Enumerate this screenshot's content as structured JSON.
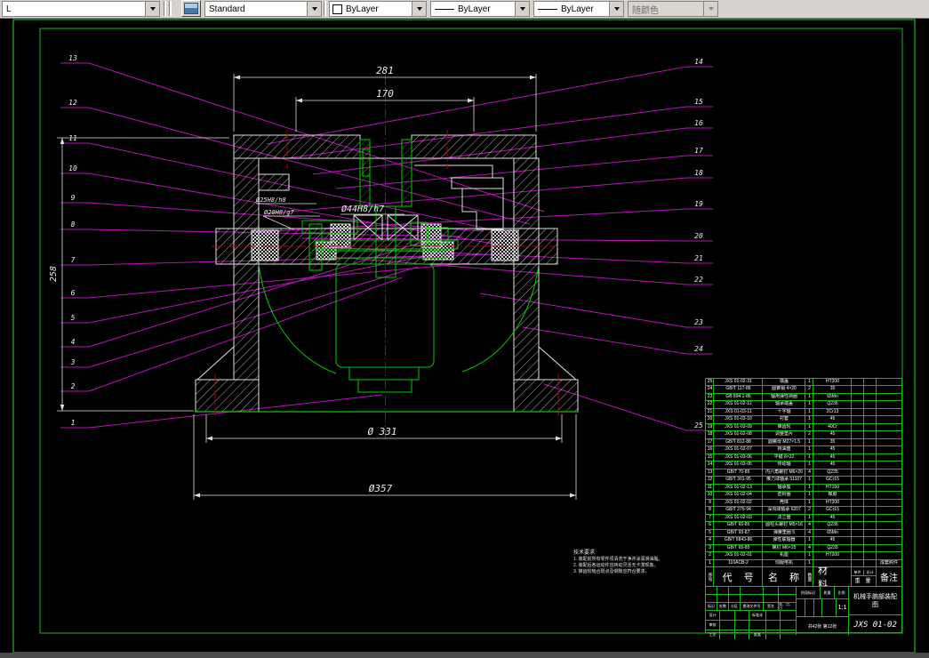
{
  "toolbar": {
    "layer_value": "L",
    "style_value": "Standard",
    "color_value": "ByLayer",
    "linetype_value": "ByLayer",
    "lineweight_value": "ByLayer",
    "plotstyle_value": "随颜色"
  },
  "colors": {
    "frame_green": "#1db21d",
    "part_green": "#00cc00",
    "line_white": "#e0e0e0",
    "leader_magenta": "#b614b6",
    "centerline_red": "#b40000"
  },
  "dims": {
    "d281": "281",
    "d170": "170",
    "d258": "258",
    "d331": "Ø 331",
    "d357": "Ø357",
    "fit1": "Ø25H8/h8",
    "fit2": "Ø20H8/g7",
    "fit3": "Ø44H8/h7"
  },
  "callouts": {
    "left": [
      "13",
      "12",
      "11",
      "10",
      "9",
      "8",
      "7",
      "6",
      "5",
      "4",
      "3",
      "2",
      "1"
    ],
    "right": [
      "14",
      "15",
      "16",
      "17",
      "18",
      "19",
      "20",
      "21",
      "22",
      "23",
      "24",
      "25"
    ]
  },
  "notes": {
    "title": "技术要求",
    "lines": [
      "1. 装配前所有零件须清洗干净并涂润滑油脂。",
      "2. 装配后各运动件应转动灵活无卡滞现象。",
      "3. 锥齿轮啮合斑点及侧隙应符合要求。"
    ]
  },
  "bom": {
    "header": {
      "seq": "序号",
      "code": "代 号",
      "name": "名 称",
      "qty": "数量",
      "material": "材 料",
      "weight_unit": "单件",
      "weight_total": "总计",
      "weight": "重 量",
      "remark": "备注"
    },
    "rows": [
      {
        "seq": "25",
        "code": "JXS 01-02-31",
        "name": "端盖",
        "qty": "1",
        "mat": "HT200",
        "remark": ""
      },
      {
        "seq": "24",
        "code": "GB/T 117-86",
        "name": "圆锥销 4×20",
        "qty": "2",
        "mat": "35",
        "remark": ""
      },
      {
        "seq": "23",
        "code": "GB 894.1-86",
        "name": "轴用弹性挡圈",
        "qty": "1",
        "mat": "65Mn",
        "remark": ""
      },
      {
        "seq": "22",
        "code": "JXS 01-02-12",
        "name": "轴承端盖",
        "qty": "1",
        "mat": "Q235",
        "remark": ""
      },
      {
        "seq": "21",
        "code": "JXS 01-03-11",
        "name": "十字轴",
        "qty": "1",
        "mat": "2Cr13",
        "remark": ""
      },
      {
        "seq": "20",
        "code": "JXS 01-03-10",
        "name": "衬套",
        "qty": "1",
        "mat": "45",
        "remark": ""
      },
      {
        "seq": "19",
        "code": "JXS 01-03-09",
        "name": "锥齿轮",
        "qty": "1",
        "mat": "40Cr",
        "remark": ""
      },
      {
        "seq": "18",
        "code": "JXS 01-02-08",
        "name": "调整垫片",
        "qty": "2",
        "mat": "45",
        "remark": ""
      },
      {
        "seq": "17",
        "code": "GB/T 812-88",
        "name": "圆螺母 M27×1.5",
        "qty": "1",
        "mat": "35",
        "remark": ""
      },
      {
        "seq": "16",
        "code": "JXS 01-02-07",
        "name": "挡油盘",
        "qty": "1",
        "mat": "45",
        "remark": ""
      },
      {
        "seq": "15",
        "code": "JXS 01-03-06",
        "name": "平键 8×22",
        "qty": "1",
        "mat": "45",
        "remark": ""
      },
      {
        "seq": "14",
        "code": "JXS 01-03-05",
        "name": "传动轴",
        "qty": "1",
        "mat": "45",
        "remark": ""
      },
      {
        "seq": "13",
        "code": "GB/T 70-85",
        "name": "内六角螺钉 M6×20",
        "qty": "4",
        "mat": "Q235",
        "remark": ""
      },
      {
        "seq": "12",
        "code": "GB/T 301-95",
        "name": "推力球轴承 51107",
        "qty": "1",
        "mat": "GCr15",
        "remark": ""
      },
      {
        "seq": "11",
        "code": "JXS 01-02-13",
        "name": "轴承座",
        "qty": "1",
        "mat": "HT150",
        "remark": ""
      },
      {
        "seq": "10",
        "code": "JXS 01-02-04",
        "name": "密封圈",
        "qty": "1",
        "mat": "橡胶",
        "remark": ""
      },
      {
        "seq": "9",
        "code": "JXS 01-02-02",
        "name": "壳体",
        "qty": "1",
        "mat": "HT200",
        "remark": ""
      },
      {
        "seq": "8",
        "code": "GB/T 276-94",
        "name": "深沟球轴承 6207",
        "qty": "2",
        "mat": "GCr15",
        "remark": ""
      },
      {
        "seq": "7",
        "code": "JXS 01-02-03",
        "name": "法兰盘",
        "qty": "1",
        "mat": "45",
        "remark": ""
      },
      {
        "seq": "6",
        "code": "GB/T 65-85",
        "name": "圆柱头螺钉 M5×16",
        "qty": "4",
        "mat": "Q235",
        "remark": ""
      },
      {
        "seq": "5",
        "code": "GB/T 93-87",
        "name": "弹簧垫圈 5",
        "qty": "4",
        "mat": "65Mn",
        "remark": ""
      },
      {
        "seq": "4",
        "code": "GB/T 5843-86",
        "name": "弹性联轴器",
        "qty": "1",
        "mat": "45",
        "remark": ""
      },
      {
        "seq": "3",
        "code": "GB/T 65-85",
        "name": "螺钉 M6×25",
        "qty": "4",
        "mat": "Q235",
        "remark": ""
      },
      {
        "seq": "2",
        "code": "JXS 01-02-01",
        "name": "机座",
        "qty": "1",
        "mat": "HT200",
        "remark": ""
      },
      {
        "seq": "1",
        "code": "110ACB-2",
        "name": "伺服电机",
        "qty": "1",
        "mat": "",
        "remark": "成套购件"
      }
    ]
  },
  "title_block": {
    "mark_labels": [
      "标记",
      "处数",
      "分区",
      "更改文件号",
      "签名",
      "年、月、日"
    ],
    "design_label": "设计",
    "standard_label": "标准化",
    "check_label": "审核",
    "process_label": "工艺",
    "approve_label": "批准",
    "stage_label": "阶段标记",
    "mass_label": "质量",
    "scale_label": "比例",
    "scale_value": "1:1",
    "sheet_info": "共42张  第12张",
    "title": "机械手腕部装配图",
    "drawing_no": "JXS 01-02"
  }
}
